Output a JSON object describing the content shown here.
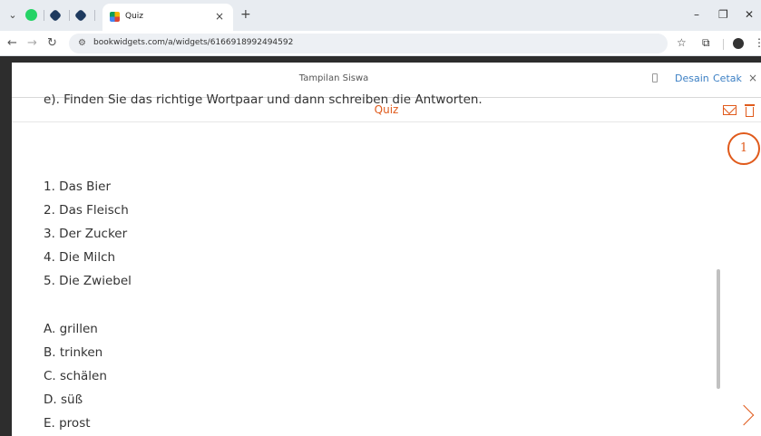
{
  "browser": {
    "tab_title": "Quiz",
    "url": "bookwidgets.com/a/widgets/6166918992494592",
    "new_tab": "+",
    "tab_close": "×"
  },
  "modal": {
    "title": "Tampilan Siswa",
    "design_link": "Desain",
    "print_link": "Cetak",
    "close": "×"
  },
  "quiz": {
    "header": "Quiz",
    "question_number": "1",
    "instruction": "e). Finden Sie das richtige Wortpaar und dann schreiben die Antworten.",
    "numbered_items": [
      "1. Das Bier",
      "2. Das Fleisch",
      "3. Der Zucker",
      "4. Die Milch",
      "5. Die Zwiebel"
    ],
    "lettered_items": [
      "A. grillen",
      "B. trinken",
      "C. schälen",
      "D. süß",
      "E. prost"
    ]
  },
  "colors": {
    "accent": "#e05a1b",
    "link": "#3b7fc4",
    "backdrop": "#2d2d2d"
  }
}
